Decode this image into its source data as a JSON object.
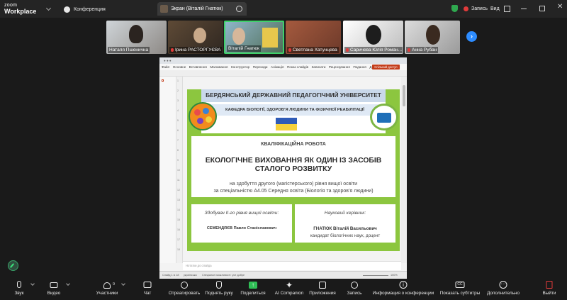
{
  "app": {
    "logo_line1": "zoom",
    "logo_line2": "Workplace"
  },
  "topbar": {
    "conference_label": "Конференция",
    "screen_tab_label": "Экран (Віталій Гнатюк)",
    "record_label": "Запись",
    "view_label": "Вид"
  },
  "participants": [
    {
      "name": "Наталя Пшенична",
      "muted": false
    },
    {
      "name": "Ірина РАСТОРГУЄВА",
      "muted": true
    },
    {
      "name": "Віталій Гнатюк",
      "muted": false
    },
    {
      "name": "Светлана Хатунцева",
      "muted": true
    },
    {
      "name": "Саричева Юлія Роман...",
      "muted": true
    },
    {
      "name": "Анна Рубан",
      "muted": true
    }
  ],
  "ppt": {
    "menu": [
      "Файл",
      "Основне",
      "Вставлення",
      "Малювання",
      "Конструктор",
      "Переходи",
      "Анімація",
      "Показ слайдів",
      "Записати",
      "Рецензування",
      "Подання",
      "Довідка"
    ],
    "share_button": "Спільний доступ",
    "slide_numbers": [
      "1",
      "2",
      "3",
      "4",
      "5",
      "6",
      "7",
      "8",
      "9",
      "10",
      "11",
      "12",
      "13",
      "14",
      "15",
      "16",
      "17",
      "18"
    ],
    "notes_placeholder": "Нотатки до слайда",
    "status_slide": "Слайд 1 із 18",
    "status_lang": "українська",
    "status_access": "Спеціальні можливості: усе добре",
    "status_zoom": "100%"
  },
  "slide": {
    "university": "БЕРДЯНСЬКИЙ ДЕРЖАВНИЙ ПЕДАГОГІЧНИЙ УНІВЕРСИТЕТ",
    "department": "КАФЕДРА БІОЛОГІЇ, ЗДОРОВ’Я ЛЮДИНИ ТА ФІЗИЧНОЇ РЕАБІЛІТАЦІЇ",
    "work_type": "КВАЛІФІКАЦІЙНА РОБОТА",
    "title_line1": "ЕКОЛОГІЧНЕ ВИХОВАННЯ ЯК ОДИН ІЗ ЗАСОБІВ",
    "title_line2": "СТАЛОГО РОЗВИТКУ",
    "subtitle_line1": "на здобуття другого (магістерського) рівня вищої освіти",
    "subtitle_line2": "за спеціальністю А4.05 Середня освіта (Біологія та здоров’я людини)",
    "student_label": "Здобувач II-го рівня вищої освіти:",
    "student_name": "СЕМЕНДЯЄВ Павло Станіславович",
    "supervisor_label": "Науковий керівник:",
    "supervisor_name": "ГНАТЮК Віталій Васильович",
    "supervisor_degree": "кандидат біологічних наук, доцент"
  },
  "toolbar": {
    "audio": "Звук",
    "video": "Видео",
    "participants": "Участники",
    "participants_count": "9",
    "chat": "Чат",
    "react": "Отреагировать",
    "raise_hand": "Поднять руку",
    "share": "Поделиться",
    "ai": "AI Companion",
    "apps": "Приложения",
    "record": "Запись",
    "info": "Информация о конференции",
    "captions": "Показать субтитры",
    "more": "Дополнительно",
    "leave": "Выйти"
  },
  "colors": {
    "slide_green": "#8cc63f",
    "accent_blue": "#2d8cff",
    "record_red": "#e23b3b"
  }
}
